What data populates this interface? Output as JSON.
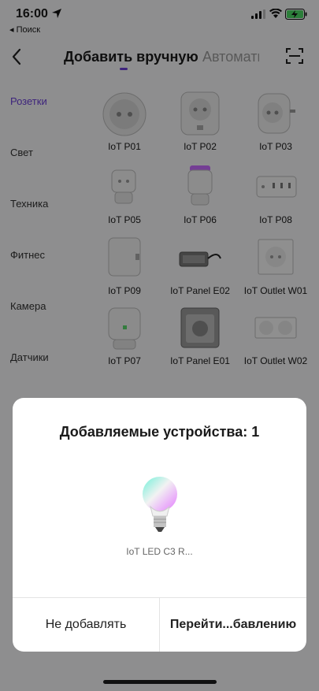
{
  "status": {
    "time": "16:00",
    "back_app": "◂ Поиск"
  },
  "nav": {
    "tab_manual": "Добавить вручную",
    "tab_auto": "Автоматически"
  },
  "categories": [
    "Розетки",
    "Свет",
    "Техника",
    "Фитнес",
    "Камера",
    "Датчики"
  ],
  "devices": [
    {
      "label": "IoT P01"
    },
    {
      "label": "IoT P02"
    },
    {
      "label": "IoT P03"
    },
    {
      "label": "IoT P05"
    },
    {
      "label": "IoT P06"
    },
    {
      "label": "IoT P08"
    },
    {
      "label": "IoT P09"
    },
    {
      "label": "IoT Panel E02"
    },
    {
      "label": "IoT Outlet W01"
    },
    {
      "label": "IoT P07"
    },
    {
      "label": "IoT Panel E01"
    },
    {
      "label": "IoT Outlet W02"
    }
  ],
  "dialog": {
    "title": "Добавляемые устройства: 1",
    "device_name": "IoT LED C3 R...",
    "skip_label": "Не добавлять",
    "go_label": "Перейти...бавлению"
  },
  "colors": {
    "accent": "#6b3fd6",
    "battery": "#4cd964"
  }
}
